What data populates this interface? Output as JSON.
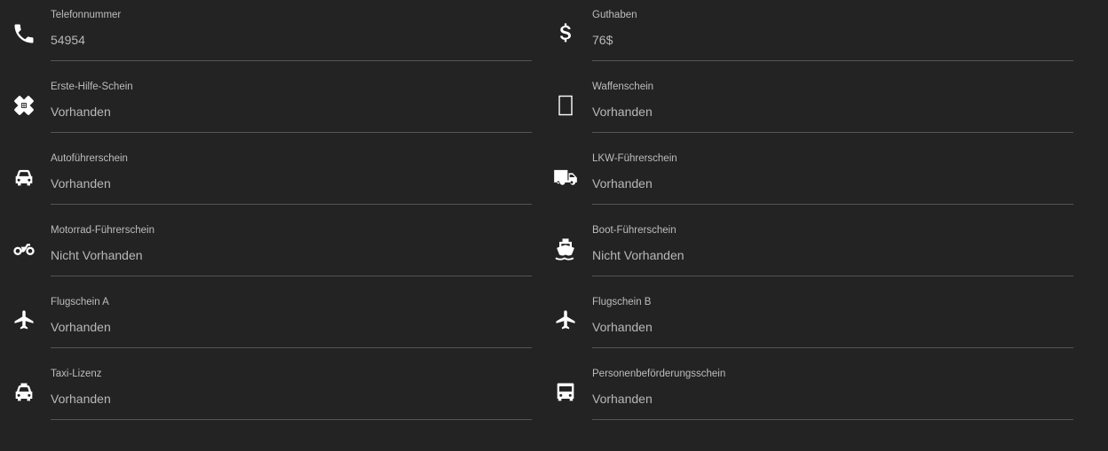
{
  "fields": {
    "phone": {
      "label": "Telefonnummer",
      "value": "54954",
      "icon": "phone-icon"
    },
    "first_aid": {
      "label": "Erste-Hilfe-Schein",
      "value": "Vorhanden",
      "icon": "bandage-icon"
    },
    "car": {
      "label": "Autoführerschein",
      "value": "Vorhanden",
      "icon": "car-icon"
    },
    "motorbike": {
      "label": "Motorrad-Führerschein",
      "value": "Nicht Vorhanden",
      "icon": "motorcycle-icon"
    },
    "flight_a": {
      "label": "Flugschein A",
      "value": "Vorhanden",
      "icon": "airplane-icon"
    },
    "taxi": {
      "label": "Taxi-Lizenz",
      "value": "Vorhanden",
      "icon": "taxi-icon"
    },
    "balance": {
      "label": "Guthaben",
      "value": "76$",
      "icon": "dollar-icon"
    },
    "weapon": {
      "label": "Waffenschein",
      "value": "Vorhanden",
      "icon": "missing-glyph-icon"
    },
    "truck": {
      "label": "LKW-Führerschein",
      "value": "Vorhanden",
      "icon": "truck-icon"
    },
    "boat": {
      "label": "Boot-Führerschein",
      "value": "Nicht Vorhanden",
      "icon": "ship-icon"
    },
    "flight_b": {
      "label": "Flugschein B",
      "value": "Vorhanden",
      "icon": "airplane-icon"
    },
    "passenger": {
      "label": "Personenbeförderungsschein",
      "value": "Vorhanden",
      "icon": "bus-icon"
    }
  },
  "colors": {
    "background": "#232323",
    "label": "#bdbdbd",
    "value": "#b8b8b8",
    "divider": "#555555",
    "icon": "#ffffff"
  }
}
